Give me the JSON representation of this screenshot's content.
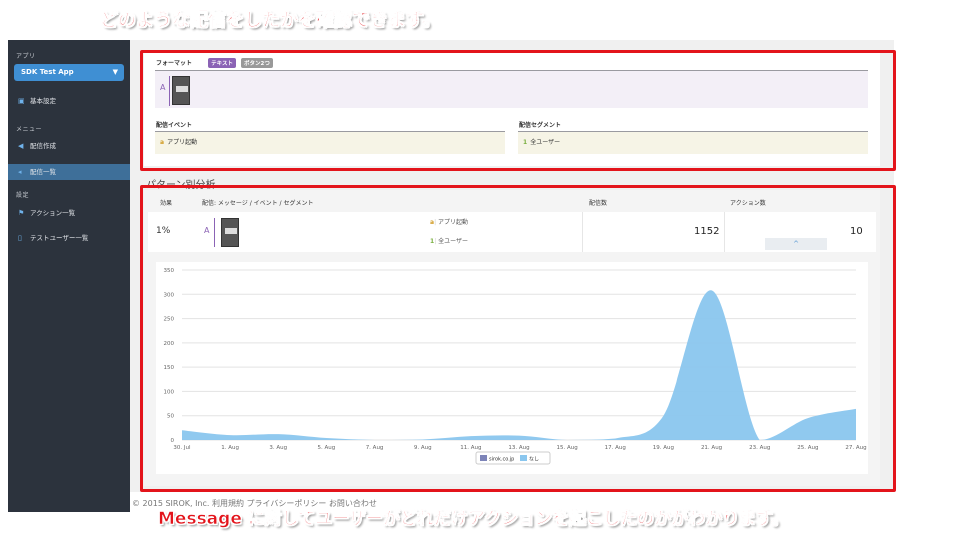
{
  "annotations": {
    "top_caption": "どのような配信をしたかを確認できます。",
    "bottom_caption": "Message に対してユーザーがどれだけアクションを起こしたのかがわかります。"
  },
  "sidebar": {
    "app_heading": "アプリ",
    "app_selected": "SDK Test App",
    "items_top": [
      {
        "label": "基本設定",
        "icon": "dashboard-icon"
      }
    ],
    "menu_heading": "メニュー",
    "menu_items": [
      {
        "label": "配信作成",
        "icon": "send-icon"
      },
      {
        "label": "配信一覧",
        "icon": "megaphone-icon"
      }
    ],
    "settings_heading": "設定",
    "settings_items": [
      {
        "label": "アクション一覧",
        "icon": "flag-icon"
      },
      {
        "label": "テストユーザー一覧",
        "icon": "mobile-icon"
      }
    ]
  },
  "delivery": {
    "format_label": "フォーマット",
    "tags": [
      "テキスト",
      "ボタン2つ"
    ],
    "preview_letter": "A",
    "event_label": "配信イベント",
    "event_key": "a",
    "event_value": "アプリ起動",
    "segment_label": "配信セグメント",
    "segment_key": "1",
    "segment_value": "全ユーザー"
  },
  "analysis": {
    "title": "パターン別分析",
    "headers": [
      "効果",
      "配信: メッセージ / イベント / セグメント",
      "配信数",
      "アクション数"
    ],
    "row": {
      "effect": "1%",
      "letter": "A",
      "event_key": "a",
      "event": "アプリ起動",
      "segment_key": "1",
      "segment": "全ユーザー",
      "deliveries": "1152",
      "actions": "10",
      "collapse": "^"
    }
  },
  "chart_data": {
    "type": "area",
    "x": [
      "30. Jul",
      "1. Aug",
      "3. Aug",
      "5. Aug",
      "7. Aug",
      "9. Aug",
      "11. Aug",
      "13. Aug",
      "15. Aug",
      "17. Aug",
      "19. Aug",
      "21. Aug",
      "23. Aug",
      "25. Aug",
      "27. Aug"
    ],
    "ylim": [
      0,
      350
    ],
    "yticks": [
      0,
      50,
      100,
      150,
      200,
      250,
      300,
      350
    ],
    "series": [
      {
        "name": "sirok.co.jp",
        "color": "#7d84b8",
        "values": [
          0,
          0,
          0,
          0,
          0,
          0,
          0,
          0,
          0,
          0,
          0,
          0,
          0,
          0,
          0
        ]
      },
      {
        "name": "なし",
        "color": "#8ac6ee",
        "values": [
          20,
          10,
          12,
          4,
          0,
          1,
          8,
          9,
          0,
          3,
          50,
          308,
          0,
          45,
          64
        ]
      }
    ],
    "legend": "bottom"
  },
  "footer": "© 2015 SIROK, Inc.  利用規約  プライバシーポリシー  お問い合わせ"
}
